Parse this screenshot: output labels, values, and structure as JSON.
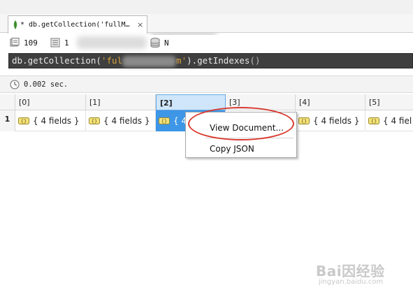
{
  "tab": {
    "title": "* db.getCollection('fullM…",
    "close": "×",
    "icon": "mongodb-leaf-icon"
  },
  "info": {
    "count": "109",
    "items": "1",
    "server": "N"
  },
  "query": {
    "prefix": "db.getCollection(",
    "string_visible_start": "'ful",
    "string_visible_end": "m'",
    "suffix": ").getIndexes",
    "parens": "()"
  },
  "timing": {
    "label": "0.002 sec."
  },
  "grid": {
    "columns": [
      "[0]",
      "[1]",
      "[2]",
      "[3]",
      "[4]",
      "[5]"
    ],
    "selected_column": "[2]",
    "rows": [
      {
        "num": "1",
        "cells": [
          "{ 4 fields }",
          "{ 4 fields }",
          "{ 4",
          "",
          "{ 4 fields }",
          "{ 4 fiel"
        ]
      }
    ]
  },
  "context_menu": {
    "items": [
      "View Document...",
      "Copy JSON"
    ]
  },
  "watermark": {
    "main": "Bai因经验",
    "sub": "jingyan.baidu.com"
  },
  "colors": {
    "accent": "#3d96e6",
    "highlight": "#d93a2f",
    "query_bg": "#3f3f3f",
    "string": "#d9a23b"
  }
}
